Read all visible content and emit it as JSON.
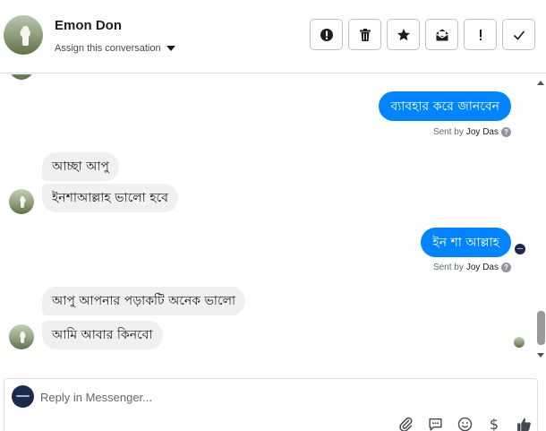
{
  "header": {
    "contact_name": "Emon Don",
    "assign_label": "Assign this conversation",
    "actions": [
      {
        "name": "mark-spam-button",
        "icon": "exclamation-circle-icon"
      },
      {
        "name": "delete-button",
        "icon": "trash-icon"
      },
      {
        "name": "star-button",
        "icon": "star-icon"
      },
      {
        "name": "mark-unread-button",
        "icon": "envelope-icon"
      },
      {
        "name": "mark-important-button",
        "icon": "exclamation-icon"
      },
      {
        "name": "mark-done-button",
        "icon": "checkmark-icon"
      }
    ]
  },
  "messages": [
    {
      "direction": "outgoing",
      "text": "ব্যাবহার করে  জানবেন",
      "sent_prefix": "Sent by",
      "sent_by": "Joy Das"
    },
    {
      "direction": "incoming",
      "text": "আচ্ছা  আপু"
    },
    {
      "direction": "incoming",
      "text": "ইনশাআল্লাহ  ভালো হবে"
    },
    {
      "direction": "outgoing",
      "text": "ইন শা আল্লাহ",
      "sent_prefix": "Sent by",
      "sent_by": "Joy Das"
    },
    {
      "direction": "incoming",
      "text": "আপু আপনার পড়াকটি অনেক ভালো"
    },
    {
      "direction": "incoming",
      "text": "আমি আবার কিনবো"
    }
  ],
  "composer": {
    "placeholder": "Reply in Messenger...",
    "tools": [
      "paperclip-icon",
      "chat-bubble-icon",
      "smiley-icon",
      "dollar-icon",
      "thumbs-up-icon"
    ],
    "dollar_glyph": "$"
  },
  "colors": {
    "outgoing_bubble": "#0084ff",
    "incoming_bubble": "#f1f0f0",
    "border": "#dddfe2"
  }
}
